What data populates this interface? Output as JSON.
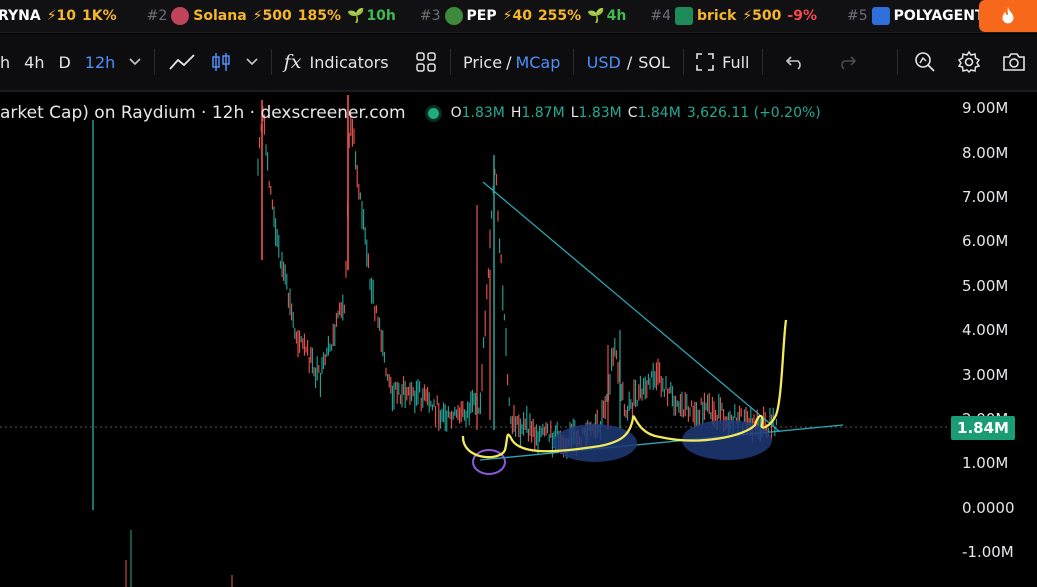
{
  "ticker": [
    {
      "rank": "",
      "symbol": "RYNA",
      "boost": "⚡10",
      "pct": "1K%",
      "pct_dir": "up",
      "age": "",
      "icon_color": ""
    },
    {
      "rank": "#2",
      "symbol": "Solana",
      "boost": "⚡500",
      "pct": "185%",
      "pct_dir": "up",
      "age": "10h",
      "icon_color": "#c0445a"
    },
    {
      "rank": "#3",
      "symbol": "PEP",
      "boost": "⚡40",
      "pct": "255%",
      "pct_dir": "up",
      "age": "4h",
      "icon_color": "#3c8a3c"
    },
    {
      "rank": "#4",
      "symbol": "brick",
      "boost": "⚡500",
      "pct": "-9%",
      "pct_dir": "down",
      "age": "",
      "icon_color": "#1d8a58"
    },
    {
      "rank": "#5",
      "symbol": "POLYAGENT",
      "boost": "",
      "pct": "",
      "pct_dir": "",
      "age": "",
      "icon_color": "#2f6fdc"
    }
  ],
  "toolbar": {
    "intervals": [
      "h",
      "4h",
      "D",
      "12h"
    ],
    "active_interval": "12h",
    "indicators_label": "Indicators",
    "price_label": "Price",
    "slash": "/",
    "mcap_label": "MCap",
    "usd_label": "USD",
    "sol_label": "SOL",
    "full_label": "Full"
  },
  "legend": {
    "title": "arket Cap) on Raydium · 12h · dexscreener.com",
    "o_label": "O",
    "o_value": "1.83M",
    "h_label": "H",
    "h_value": "1.87M",
    "l_label": "L",
    "l_value": "1.83M",
    "c_label": "C",
    "c_value": "1.84M",
    "change": "3,626.11 (+0.20%)"
  },
  "y_axis": [
    "9.00M",
    "8.00M",
    "7.00M",
    "6.00M",
    "5.00M",
    "4.00M",
    "3.00M",
    "2.00M",
    "1.00M",
    "0.0000",
    "-1.00M"
  ],
  "current_price": "1.84M",
  "colors": {
    "up": "#26a69a",
    "down": "#ef5350",
    "trendline": "#2aa6b5",
    "drawing": "#f2ea5a",
    "highlight": "#1e3a78",
    "circle": "#8a5ad8",
    "accent": "#f7681a"
  }
}
